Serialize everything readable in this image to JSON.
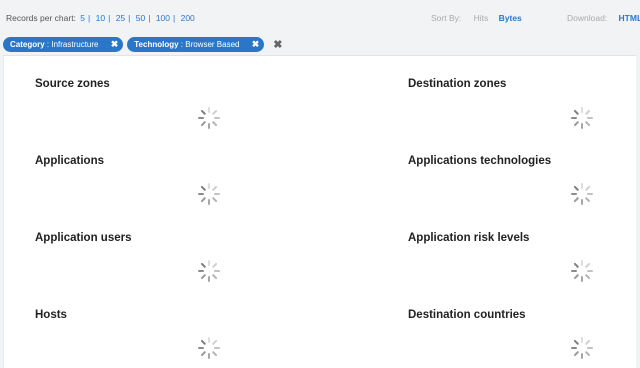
{
  "toolbar": {
    "records_label": "Records per chart:",
    "records_options": [
      "5",
      "10",
      "25",
      "50",
      "100",
      "200"
    ],
    "sort_label": "Sort By:",
    "sort_hits": "Hits",
    "sort_bytes": "Bytes",
    "download_label": "Download:",
    "download_html": "HTML"
  },
  "filters": [
    {
      "key": "Category",
      "value": " : Infrastructure"
    },
    {
      "key": "Technology",
      "value": " : Browser Based"
    }
  ],
  "widgets": [
    {
      "title": "Source zones"
    },
    {
      "title": "Destination zones"
    },
    {
      "title": "Applications"
    },
    {
      "title": "Applications technologies"
    },
    {
      "title": "Application users"
    },
    {
      "title": "Application risk levels"
    },
    {
      "title": "Hosts"
    },
    {
      "title": "Destination countries"
    }
  ],
  "icons": {
    "remove_filter": "✖",
    "clear_filters": "✖",
    "loading": "spinner-icon"
  },
  "colors": {
    "accent": "#2a77c9",
    "background": "#f2f3f5"
  }
}
